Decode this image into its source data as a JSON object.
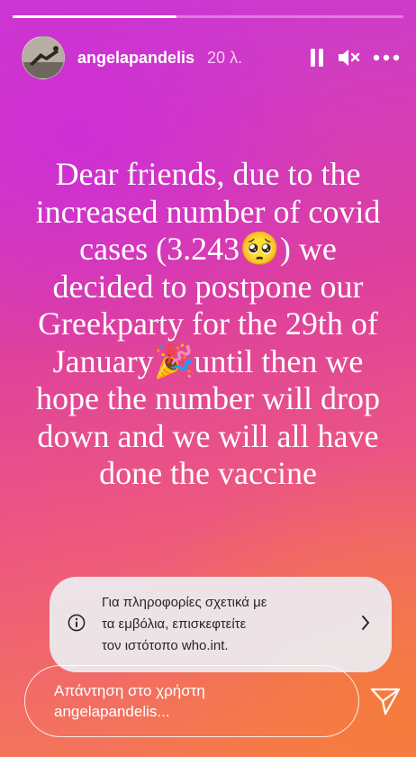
{
  "story": {
    "progress": 0.42
  },
  "header": {
    "username": "angelapandelis",
    "timestamp": "20 λ."
  },
  "content": {
    "text": "Dear friends, due to the increased number of covid cases (3.243🥺) we decided to postpone our Greekparty for the 29th of January🎉until then we hope the number will drop down and we will all have done the vaccine"
  },
  "info_banner": {
    "line1": "Για πληροφορίες σχετικά με",
    "line2": "τα εμβόλια, επισκεφτείτε",
    "line3": "τον ιστότοπο who.int."
  },
  "reply": {
    "line1": "Απάντηση στο χρήστη",
    "line2": "angelapandelis..."
  },
  "colors": {
    "gradient_top": "#c93ad4",
    "gradient_bottom": "#f57d4f"
  },
  "icons": [
    "pause-icon",
    "mute-icon",
    "more-options-icon",
    "info-icon",
    "chevron-right-icon",
    "send-icon"
  ]
}
